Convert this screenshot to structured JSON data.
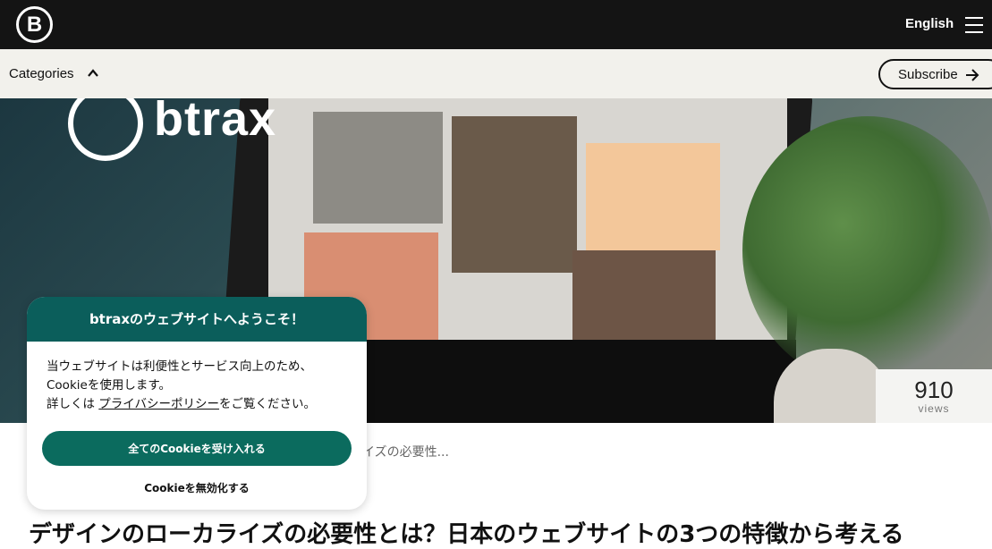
{
  "header": {
    "logo_icon": "btrax-logo-icon",
    "logo_letter": "B",
    "language": "English",
    "menu_icon": "hamburger-menu-icon"
  },
  "category_bar": {
    "categories_label": "Categories",
    "chevron_icon": "chevron-up-icon",
    "subscribe_label": "Subscribe",
    "subscribe_icon": "arrow-right-icon"
  },
  "hero": {
    "brand_text": "btrax",
    "views_count": "910",
    "views_label": "views"
  },
  "breadcrumb": {
    "tail_text": "イズの必要性..."
  },
  "article": {
    "title": "デザインのローカライズの必要性とは？日本のウェブサイトの3つの特徴から考える"
  },
  "cookie_banner": {
    "title": "btraxのウェブサイトへようこそ！",
    "line1": "当ウェブサイトは利便性とサービス向上のため、",
    "line2": "Cookieを使用します。",
    "line3_prefix": "詳しくは ",
    "privacy_link": "プライバシーポリシー",
    "line3_suffix": "をご覧ください。",
    "accept_label": "全てのCookieを受け入れる",
    "decline_label": "Cookieを無効化する",
    "colors": {
      "header": "#0b5e5b",
      "accept_button": "#0b6b5e"
    }
  }
}
